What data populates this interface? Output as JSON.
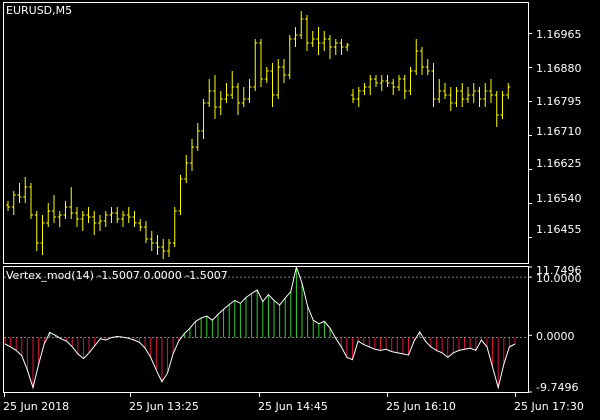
{
  "main_title": "EURUSD,M5",
  "indicator_title": "Vertex_mod(14) -1.5007 0.0000 -1.5007",
  "colors": {
    "background": "#000000",
    "frame": "#ffffff",
    "price_bars": "#ffff00",
    "osc_positive": "#32cd32",
    "osc_negative": "#dc143c",
    "osc_line": "#ffffff",
    "level_line": "#808080",
    "text": "#ffffff"
  },
  "price_axis_labels": [
    "1.16965",
    "1.16880",
    "1.16795",
    "1.16710",
    "1.16625",
    "1.16540",
    "1.16455"
  ],
  "indicator_axis_labels": [
    "11.7496",
    "10.0000",
    "0.0000",
    "-9.7496"
  ],
  "time_axis_labels": [
    "25 Jun 2018",
    "25 Jun 13:25",
    "25 Jun 14:45",
    "25 Jun 16:10",
    "25 Jun 17:30"
  ],
  "chart_data": [
    {
      "type": "bar",
      "title": "EURUSD,M5",
      "description": "OHLC price bars, 5-minute",
      "ylim": [
        1.1639,
        1.1704
      ],
      "y_ticks": [
        1.16965,
        1.1688,
        1.16795,
        1.1671,
        1.16625,
        1.1654,
        1.16455
      ],
      "x_tick_labels": [
        "25 Jun 2018",
        "25 Jun 13:25",
        "25 Jun 14:45",
        "25 Jun 16:10",
        "25 Jun 17:30"
      ],
      "bars": [
        [
          1.16535,
          1.16545,
          1.1652,
          1.1653
        ],
        [
          1.1653,
          1.1657,
          1.1651,
          1.1656
        ],
        [
          1.1656,
          1.1659,
          1.1654,
          1.16555
        ],
        [
          1.16555,
          1.16605,
          1.1654,
          1.1658
        ],
        [
          1.1658,
          1.1659,
          1.165,
          1.1651
        ],
        [
          1.1651,
          1.1652,
          1.1642,
          1.1644
        ],
        [
          1.1644,
          1.1651,
          1.1641,
          1.1649
        ],
        [
          1.1649,
          1.1654,
          1.1648,
          1.1652
        ],
        [
          1.1652,
          1.1656,
          1.1649,
          1.16505
        ],
        [
          1.16505,
          1.1652,
          1.1648,
          1.1651
        ],
        [
          1.1651,
          1.16545,
          1.165,
          1.1653
        ],
        [
          1.1653,
          1.1658,
          1.165,
          1.16515
        ],
        [
          1.16515,
          1.1653,
          1.1648,
          1.165
        ],
        [
          1.165,
          1.1652,
          1.1647,
          1.1651
        ],
        [
          1.1651,
          1.1653,
          1.1649,
          1.16505
        ],
        [
          1.16505,
          1.1652,
          1.1646,
          1.1649
        ],
        [
          1.1649,
          1.1651,
          1.1647,
          1.16495
        ],
        [
          1.16495,
          1.1652,
          1.1648,
          1.1651
        ],
        [
          1.1651,
          1.1653,
          1.1649,
          1.16515
        ],
        [
          1.16515,
          1.1653,
          1.1649,
          1.165
        ],
        [
          1.165,
          1.1652,
          1.1648,
          1.1651
        ],
        [
          1.1651,
          1.1653,
          1.1649,
          1.16505
        ],
        [
          1.16505,
          1.1652,
          1.1648,
          1.1649
        ],
        [
          1.1649,
          1.165,
          1.1647,
          1.1648
        ],
        [
          1.1648,
          1.16495,
          1.1644,
          1.1645
        ],
        [
          1.1645,
          1.1647,
          1.1642,
          1.1644
        ],
        [
          1.1644,
          1.1646,
          1.1641,
          1.1643
        ],
        [
          1.1643,
          1.1645,
          1.164,
          1.1642
        ],
        [
          1.1642,
          1.1645,
          1.16405,
          1.1644
        ],
        [
          1.1644,
          1.1653,
          1.1643,
          1.1652
        ],
        [
          1.1652,
          1.1661,
          1.1651,
          1.166
        ],
        [
          1.166,
          1.1666,
          1.1659,
          1.1664
        ],
        [
          1.1664,
          1.167,
          1.1662,
          1.1668
        ],
        [
          1.1668,
          1.1674,
          1.1667,
          1.1672
        ],
        [
          1.1672,
          1.168,
          1.167,
          1.1679
        ],
        [
          1.1679,
          1.1685,
          1.1678,
          1.1682
        ],
        [
          1.1682,
          1.1686,
          1.1675,
          1.1678
        ],
        [
          1.1678,
          1.1682,
          1.1676,
          1.168
        ],
        [
          1.168,
          1.1684,
          1.1679,
          1.1681
        ],
        [
          1.1681,
          1.1687,
          1.168,
          1.1683
        ],
        [
          1.1683,
          1.1684,
          1.1676,
          1.1679
        ],
        [
          1.1679,
          1.1683,
          1.1678,
          1.168
        ],
        [
          1.168,
          1.1685,
          1.1679,
          1.1683
        ],
        [
          1.1683,
          1.1695,
          1.1682,
          1.1694
        ],
        [
          1.1694,
          1.1695,
          1.1683,
          1.1685
        ],
        [
          1.1685,
          1.1688,
          1.1684,
          1.1687
        ],
        [
          1.1687,
          1.1689,
          1.1678,
          1.1681
        ],
        [
          1.1681,
          1.169,
          1.168,
          1.1688
        ],
        [
          1.1688,
          1.169,
          1.1684,
          1.1686
        ],
        [
          1.1686,
          1.1696,
          1.1685,
          1.1695
        ],
        [
          1.1695,
          1.1698,
          1.1693,
          1.1696
        ],
        [
          1.1696,
          1.1702,
          1.1695,
          1.17
        ],
        [
          1.17,
          1.1701,
          1.1692,
          1.1694
        ],
        [
          1.1694,
          1.1697,
          1.1693,
          1.1695
        ],
        [
          1.1695,
          1.1698,
          1.1691,
          1.1694
        ],
        [
          1.1694,
          1.1697,
          1.1692,
          1.1695
        ],
        [
          1.1695,
          1.1696,
          1.169,
          1.1693
        ],
        [
          1.1693,
          1.1695,
          1.1691,
          1.1694
        ],
        [
          1.1694,
          1.1695,
          1.1691,
          1.1693
        ],
        [
          1.1693,
          1.1694,
          1.1692,
          1.16935
        ],
        [
          1.1681,
          1.16825,
          1.1679,
          1.168
        ],
        [
          1.168,
          1.1683,
          1.1678,
          1.1682
        ],
        [
          1.1682,
          1.1684,
          1.1681,
          1.1683
        ],
        [
          1.1683,
          1.1686,
          1.1681,
          1.1685
        ],
        [
          1.1685,
          1.1686,
          1.1683,
          1.1684
        ],
        [
          1.1684,
          1.1686,
          1.1682,
          1.16845
        ],
        [
          1.16845,
          1.1686,
          1.1683,
          1.1684
        ],
        [
          1.1684,
          1.1685,
          1.1681,
          1.1683
        ],
        [
          1.1683,
          1.1686,
          1.1682,
          1.1685
        ],
        [
          1.1685,
          1.1686,
          1.168,
          1.1682
        ],
        [
          1.1682,
          1.1688,
          1.1681,
          1.1687
        ],
        [
          1.1687,
          1.1695,
          1.1686,
          1.1692
        ],
        [
          1.1692,
          1.1693,
          1.1686,
          1.1688
        ],
        [
          1.1688,
          1.169,
          1.1686,
          1.1687
        ],
        [
          1.1687,
          1.1689,
          1.1678,
          1.168
        ],
        [
          1.168,
          1.1685,
          1.1679,
          1.1682
        ],
        [
          1.1682,
          1.1684,
          1.168,
          1.1681
        ],
        [
          1.1681,
          1.1683,
          1.1677,
          1.1679
        ],
        [
          1.1679,
          1.1683,
          1.1678,
          1.1682
        ],
        [
          1.1682,
          1.1684,
          1.1678,
          1.168
        ],
        [
          1.168,
          1.1683,
          1.1679,
          1.1681
        ],
        [
          1.1681,
          1.1684,
          1.1679,
          1.1682
        ],
        [
          1.1682,
          1.1683,
          1.1678,
          1.168
        ],
        [
          1.168,
          1.1684,
          1.1678,
          1.1682
        ],
        [
          1.1682,
          1.1685,
          1.1679,
          1.1681
        ],
        [
          1.1681,
          1.1682,
          1.1673,
          1.1676
        ],
        [
          1.1676,
          1.1682,
          1.1675,
          1.1681
        ],
        [
          1.1681,
          1.1684,
          1.168,
          1.1683
        ]
      ]
    },
    {
      "type": "area",
      "title": "Vertex_mod(14)",
      "ylim": [
        -9.7496,
        11.7496
      ],
      "y_ticks": [
        11.7496,
        10.0,
        0.0,
        -9.7496
      ],
      "levels": [
        10.0,
        0.0
      ],
      "values": [
        -1.5,
        -2.0,
        -2.6,
        -3.5,
        -6.0,
        -9.0,
        -5.0,
        -1.5,
        0.5,
        0.0,
        -0.6,
        -1.0,
        -2.0,
        -3.2,
        -4.0,
        -3.0,
        -1.8,
        -0.6,
        -0.8,
        -0.4,
        -0.2,
        -0.3,
        -0.5,
        -0.8,
        -1.2,
        -2.2,
        -3.8,
        -6.0,
        -8.0,
        -6.5,
        -3.2,
        -1.0,
        0.3,
        1.2,
        2.4,
        3.0,
        3.3,
        2.6,
        3.6,
        4.5,
        5.3,
        6.0,
        5.5,
        6.5,
        7.2,
        7.8,
        5.8,
        7.0,
        6.0,
        5.2,
        6.4,
        7.5,
        11.7496,
        9.0,
        5.0,
        2.6,
        2.0,
        2.4,
        1.2,
        -0.5,
        -2.0,
        -3.8,
        -4.2,
        -1.0,
        -1.6,
        -2.0,
        -2.4,
        -2.6,
        -2.4,
        -2.8,
        -3.0,
        -3.2,
        -3.4,
        -1.0,
        0.6,
        -1.0,
        -2.0,
        -2.6,
        -3.0,
        -3.8,
        -3.0,
        -2.6,
        -2.4,
        -2.2,
        -2.6,
        -0.8,
        -2.0,
        -5.5,
        -9.0,
        -5.0,
        -2.0,
        -1.5007
      ]
    }
  ]
}
